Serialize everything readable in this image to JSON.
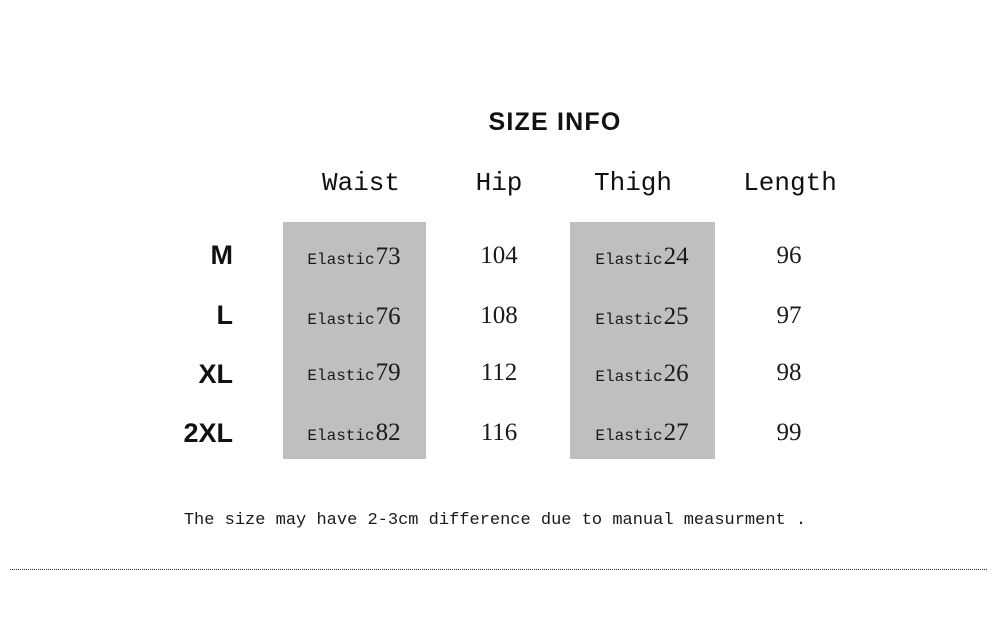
{
  "title": "SIZE INFO",
  "colors": {
    "highlight_band": "#BFBFBF",
    "text": "#111111",
    "background": "#FFFFFF",
    "divider": "#2B2B2B"
  },
  "chart_data": {
    "type": "table",
    "title": "SIZE INFO",
    "size_column_header": "",
    "columns": [
      "Waist",
      "Hip",
      "Thigh",
      "Length"
    ],
    "highlighted_columns": [
      "Waist",
      "Thigh"
    ],
    "rows": [
      {
        "size": "M",
        "waist_prefix": "Elastic",
        "waist": "73",
        "hip": "104",
        "thigh_prefix": "Elastic",
        "thigh": "24",
        "length": "96"
      },
      {
        "size": "L",
        "waist_prefix": "Elastic",
        "waist": "76",
        "hip": "108",
        "thigh_prefix": "Elastic",
        "thigh": "25",
        "length": "97"
      },
      {
        "size": "XL",
        "waist_prefix": "Elastic",
        "waist": "79",
        "hip": "112",
        "thigh_prefix": "Elastic",
        "thigh": "26",
        "length": "98"
      },
      {
        "size": "2XL",
        "waist_prefix": "Elastic",
        "waist": "82",
        "hip": "116",
        "thigh_prefix": "Elastic",
        "thigh": "27",
        "length": "99"
      }
    ],
    "unit_note": "2-3cm"
  },
  "headers": [
    {
      "label": "Waist"
    },
    {
      "label": "Hip"
    },
    {
      "label": "Thigh"
    },
    {
      "label": "Length"
    }
  ],
  "rows": [
    {
      "size": "M",
      "waist_prefix": "Elastic",
      "waist": "73",
      "hip": "104",
      "thigh_prefix": "Elastic",
      "thigh": "24",
      "length": "96"
    },
    {
      "size": "L",
      "waist_prefix": "Elastic",
      "waist": "76",
      "hip": "108",
      "thigh_prefix": "Elastic",
      "thigh": "25",
      "length": "97"
    },
    {
      "size": "XL",
      "waist_prefix": "Elastic",
      "waist": "79",
      "hip": "112",
      "thigh_prefix": "Elastic",
      "thigh": "26",
      "length": "98"
    },
    {
      "size": "2XL",
      "waist_prefix": "Elastic",
      "waist": "82",
      "hip": "116",
      "thigh_prefix": "Elastic",
      "thigh": "27",
      "length": "99"
    }
  ],
  "footer": {
    "note": "The size may have 2-3cm difference due to manual measurment ."
  }
}
